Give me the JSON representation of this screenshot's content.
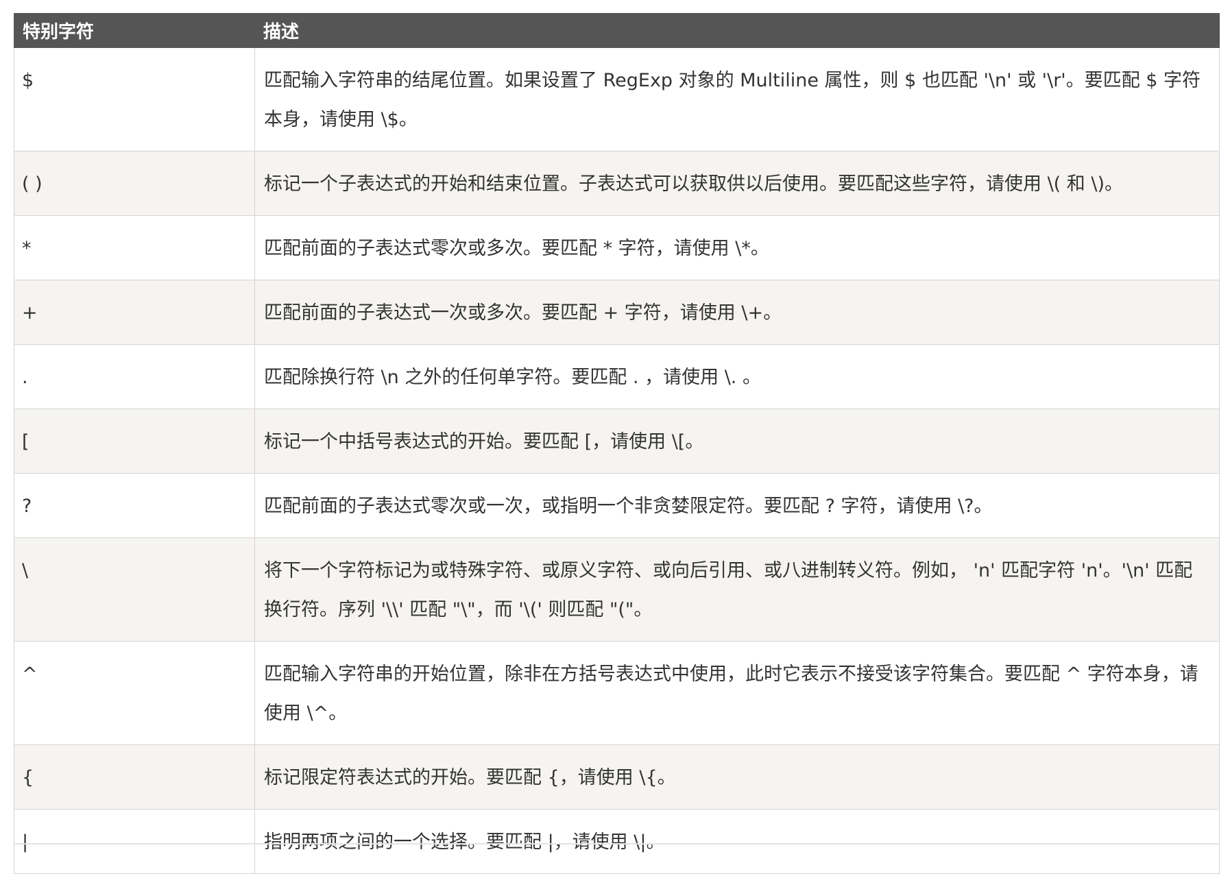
{
  "table": {
    "headers": {
      "char": "特别字符",
      "desc": "描述"
    },
    "rows": [
      {
        "char": "$",
        "desc": "匹配输入字符串的结尾位置。如果设置了 RegExp 对象的 Multiline 属性，则 $ 也匹配 '\\n' 或 '\\r'。要匹配 $ 字符本身，请使用 \\$。"
      },
      {
        "char": "( )",
        "desc": "标记一个子表达式的开始和结束位置。子表达式可以获取供以后使用。要匹配这些字符，请使用 \\( 和 \\)。"
      },
      {
        "char": "*",
        "desc": "匹配前面的子表达式零次或多次。要匹配 * 字符，请使用 \\*。"
      },
      {
        "char": "+",
        "desc": "匹配前面的子表达式一次或多次。要匹配 + 字符，请使用 \\+。"
      },
      {
        "char": ".",
        "desc": "匹配除换行符 \\n 之外的任何单字符。要匹配 . ，请使用 \\. 。"
      },
      {
        "char": "[",
        "desc": "标记一个中括号表达式的开始。要匹配 [，请使用 \\[。"
      },
      {
        "char": "?",
        "desc": "匹配前面的子表达式零次或一次，或指明一个非贪婪限定符。要匹配 ? 字符，请使用 \\?。"
      },
      {
        "char": "\\",
        "desc": "将下一个字符标记为或特殊字符、或原义字符、或向后引用、或八进制转义符。例如， 'n' 匹配字符 'n'。'\\n' 匹配换行符。序列 '\\\\' 匹配 \"\\\"，而 '\\(' 则匹配 \"(\"。"
      },
      {
        "char": "^",
        "desc": "匹配输入字符串的开始位置，除非在方括号表达式中使用，此时它表示不接受该字符集合。要匹配 ^ 字符本身，请使用 \\^。"
      },
      {
        "char": "{",
        "desc": "标记限定符表达式的开始。要匹配 {，请使用 \\{。"
      },
      {
        "char": "|",
        "desc": "指明两项之间的一个选择。要匹配 |，请使用 \\|。"
      }
    ]
  }
}
